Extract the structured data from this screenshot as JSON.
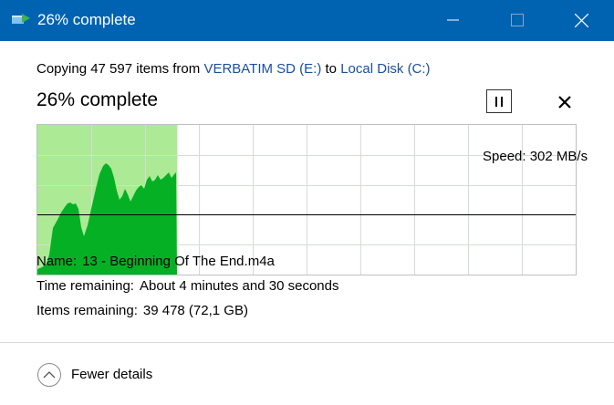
{
  "window": {
    "title": "26% complete"
  },
  "copy": {
    "prefix": "Copying 47 597 items from",
    "source": "VERBATIM SD (E:)",
    "connector": "to",
    "destination": "Local Disk (C:)",
    "percent_label": "26% complete",
    "progress": 0.26
  },
  "graph": {
    "speed_label": "Speed: 302 MB/s",
    "speed_line_level": 0.4
  },
  "details": {
    "name_label": "Name:",
    "name_value": "13 - Beginning Of The End.m4a",
    "time_label": "Time remaining:",
    "time_value": "About 4 minutes and 30 seconds",
    "items_label": "Items remaining:",
    "items_value": "39 478 (72,1 GB)"
  },
  "footer": {
    "fewer_details_label": "Fewer details"
  },
  "colors": {
    "titlebar": "#0063b1",
    "progress_fill": "#acea96",
    "speed_area": "#06b025",
    "link": "#1a4f9c"
  },
  "icons": {
    "app": "copy-transfer-icon",
    "pause": "pause-icon",
    "cancel": "close-icon",
    "toggle": "chevron-up-circle-icon"
  }
}
